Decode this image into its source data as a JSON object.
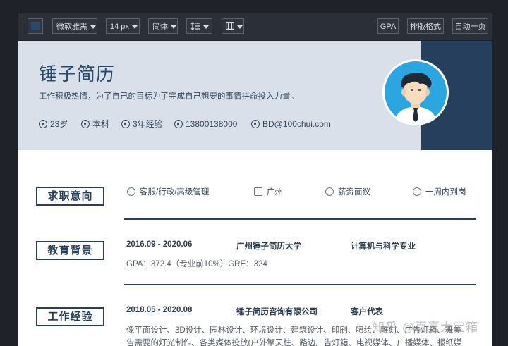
{
  "toolbar": {
    "color_swatch": "#2a4a6b",
    "font_family": "微软雅黑",
    "font_size": "14 px",
    "script": "简体",
    "gpa_label": "GPA",
    "layout_label": "排版格式",
    "onepage_label": "自动一页"
  },
  "resume": {
    "name": "锤子简历",
    "summary": "工作积极热情，为了自己的目标为了完成自己想要的事情拼命投入力量。",
    "age": "23岁",
    "degree": "本科",
    "experience_years": "3年经验",
    "phone": "13800138000",
    "email": "BD@100chui.com"
  },
  "intent": {
    "title": "求职意向",
    "position": "客服/行政/高级管理",
    "city": "广州",
    "salary": "薪资面议",
    "availability": "一周内到岗"
  },
  "education": {
    "title": "教育背景",
    "date": "2016.09 - 2020.06",
    "school": "广州锤子简历大学",
    "major": "计算机与科学专业",
    "detail": "GPA：372.4（专业前10%）GRE：324"
  },
  "work": {
    "title": "工作经验",
    "date": "2018.05 - 2020.08",
    "company": "锤子简历咨询有限公司",
    "role": "客户代表",
    "line1": "像平面设计、3D设计、园林设计、环境设计、建筑设计、印刷、喷绘、雕刻、广告灯箱、舞美",
    "line2": "告需要的灯光制作、各类媒体投放(户外擎天柱、路边广告灯箱、电视媒体、广播媒体、报纸媒"
  },
  "watermark": "知乎 @百嘉大宝箱",
  "colors": {
    "accent": "#263f5c",
    "header_bg": "#d9e0ea"
  }
}
